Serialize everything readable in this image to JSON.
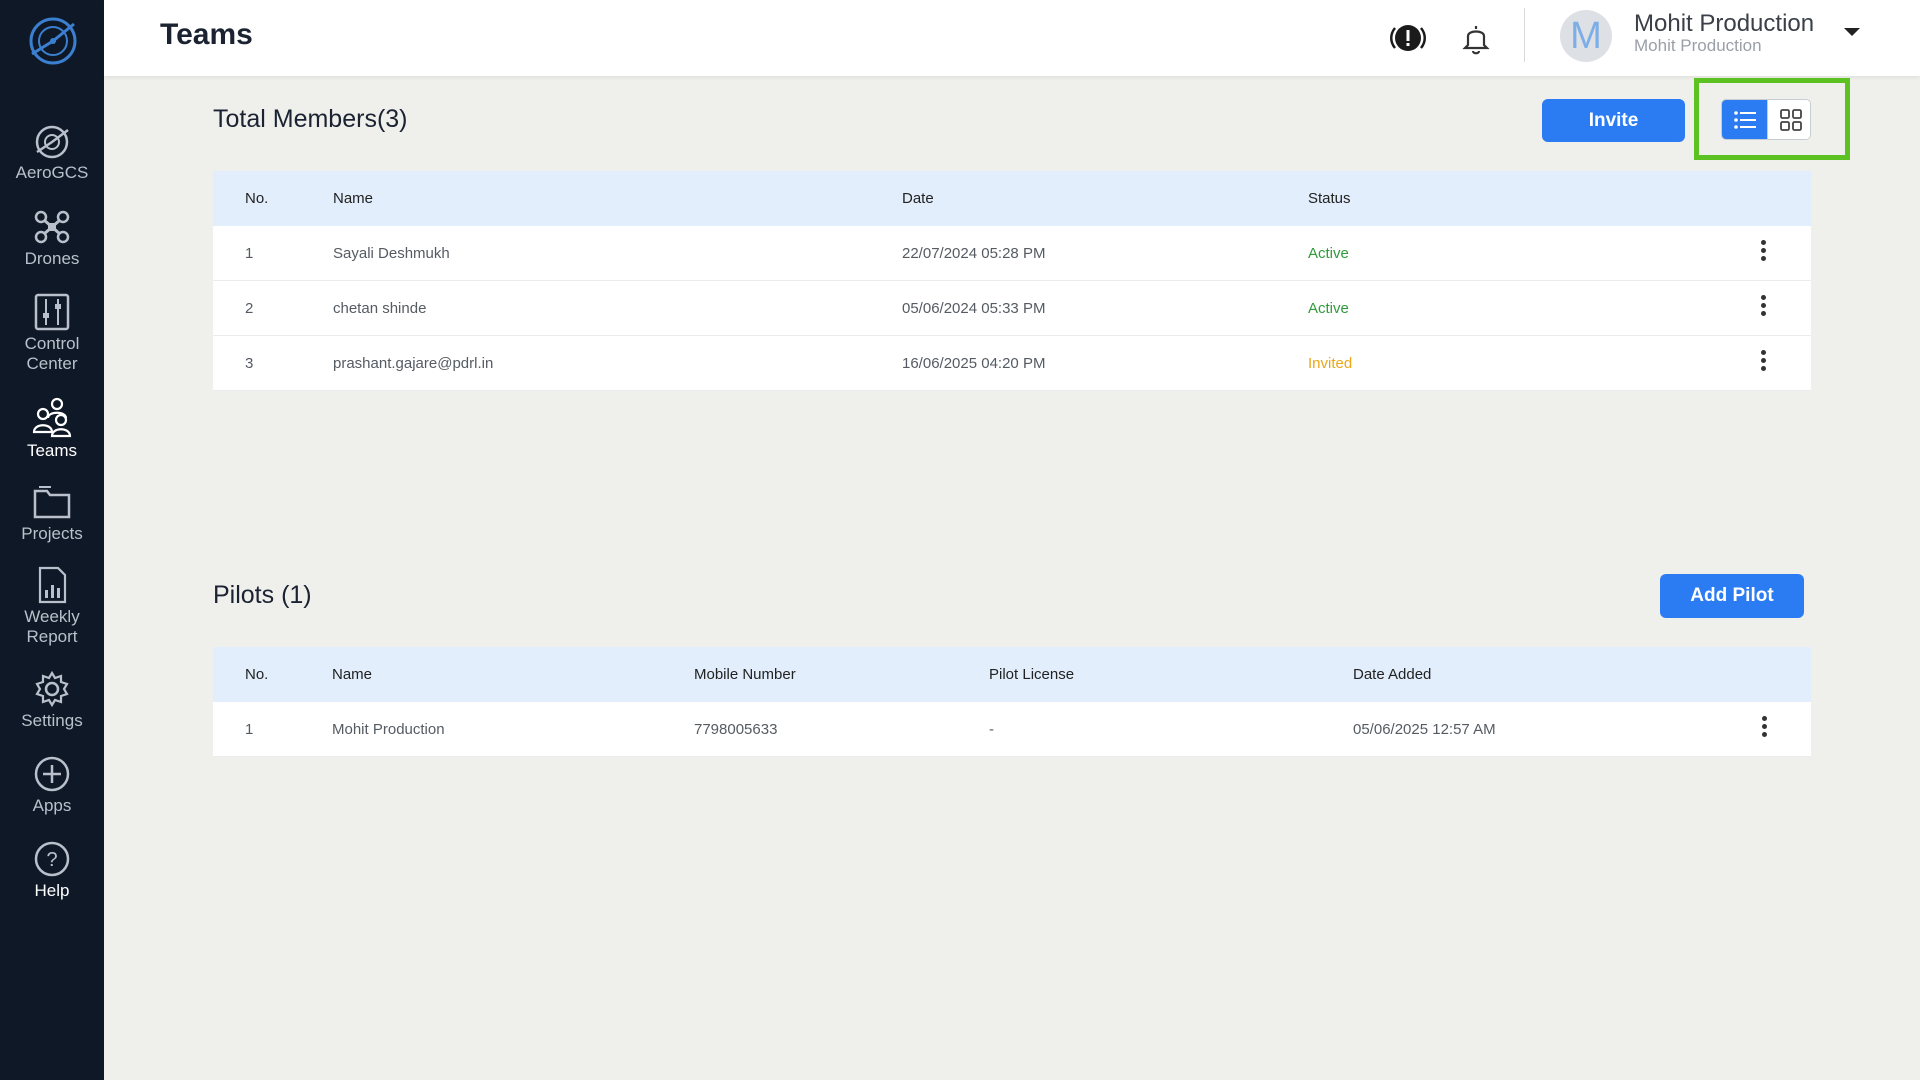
{
  "sidebar": {
    "items": [
      {
        "label": "AeroGCS",
        "icon": "aerogcs-icon"
      },
      {
        "label": "Drones",
        "icon": "drone-icon"
      },
      {
        "label": "Control Center",
        "icon": "control-center-icon"
      },
      {
        "label": "Teams",
        "icon": "teams-icon",
        "active": true
      },
      {
        "label": "Projects",
        "icon": "folder-icon"
      },
      {
        "label": "Weekly Report",
        "icon": "report-icon"
      },
      {
        "label": "Settings",
        "icon": "gear-icon"
      },
      {
        "label": "Apps",
        "icon": "plus-circle-icon"
      },
      {
        "label": "Help",
        "icon": "help-icon"
      }
    ]
  },
  "header": {
    "title": "Teams",
    "user": {
      "initial": "M",
      "name": "Mohit Production",
      "org": "Mohit Production"
    }
  },
  "members": {
    "title": "Total Members(3)",
    "invite_label": "Invite",
    "columns": [
      "No.",
      "Name",
      "Date",
      "Status"
    ],
    "rows": [
      {
        "no": "1",
        "name": "Sayali Deshmukh",
        "date": "22/07/2024 05:28 PM",
        "status": "Active"
      },
      {
        "no": "2",
        "name": "chetan shinde",
        "date": "05/06/2024 05:33 PM",
        "status": "Active"
      },
      {
        "no": "3",
        "name": "prashant.gajare@pdrl.in",
        "date": "16/06/2025 04:20 PM",
        "status": "Invited"
      }
    ]
  },
  "pilots": {
    "title": "Pilots (1)",
    "add_label": "Add Pilot",
    "columns": [
      "No.",
      "Name",
      "Mobile Number",
      "Pilot License",
      "Date Added"
    ],
    "rows": [
      {
        "no": "1",
        "name": "Mohit Production",
        "mobile": "7798005633",
        "license": "-",
        "date": "05/06/2025 12:57 AM"
      }
    ]
  },
  "colors": {
    "accent": "#2b7cf3",
    "active": "#2f9b3a",
    "invited": "#e8a81a",
    "highlight": "#5bc222",
    "sidebar": "#0f1826"
  }
}
